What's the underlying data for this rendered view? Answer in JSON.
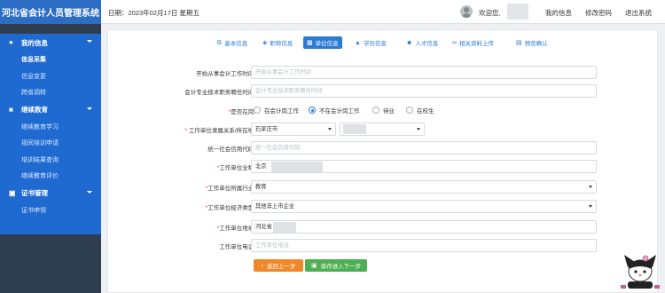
{
  "app": {
    "title": "河北省会计人员管理系统"
  },
  "header": {
    "date": "日期：2023年02月17日 星期五",
    "welcome": "欢迎您,",
    "links": [
      "我的信息",
      "修改密码",
      "退出系统"
    ]
  },
  "sidebar": {
    "groups": [
      {
        "label": "我的信息",
        "items": [
          "信息采集",
          "信息变更",
          "跨省调转"
        ]
      },
      {
        "label": "继续教育",
        "items": [
          "继续教育学习",
          "视同培训申请",
          "培训结果查询",
          "继续教育评价"
        ]
      },
      {
        "label": "证书管理",
        "items": [
          "证书申领"
        ]
      }
    ],
    "active_item": "信息采集"
  },
  "steps": [
    "基本信息",
    "职称信息",
    "单位信息",
    "学历信息",
    "人才信息",
    "相关资料上传",
    "预览确认"
  ],
  "current_step": "单位信息",
  "form": {
    "start_time": {
      "label": "开始从事会计工作时间:",
      "placeholder": "开始从事会计工作时间"
    },
    "title_time": {
      "label": "会计专业技术职务聘任时间:",
      "placeholder": "会计专业技术职务聘任时间"
    },
    "on_duty": {
      "label": "*是否在岗:",
      "options": [
        "在会计岗工作",
        "不在会计岗工作",
        "待业",
        "在校生"
      ],
      "selected": "不在会计岗工作"
    },
    "affiliation": {
      "label": "* 工作单位隶属关系/所在地:",
      "city": "石家庄市"
    },
    "credit_code": {
      "label": "统一社会信用代码:",
      "placeholder": "统一社会信用代码"
    },
    "company_name": {
      "label": "*工作单位全称:",
      "value": "北京"
    },
    "industry": {
      "label": "*工作单位所属行业:",
      "value": "教育"
    },
    "economic_type": {
      "label": "*工作单位经济类型:",
      "value": "其他非上市企业"
    },
    "address": {
      "label": "*工作单位地址:",
      "value": "河北省"
    },
    "phone": {
      "label": "工作单位电话:",
      "placeholder": "工作单位电话"
    }
  },
  "buttons": {
    "back": "返回上一步",
    "next": "保存进入下一步"
  },
  "colors": {
    "sidebar": "#1f6ad0",
    "logo": "#2b6cc4",
    "accent": "#2b7bd4",
    "back_button": "#f0882a",
    "next_button": "#4caf50",
    "required": "#e53935"
  }
}
